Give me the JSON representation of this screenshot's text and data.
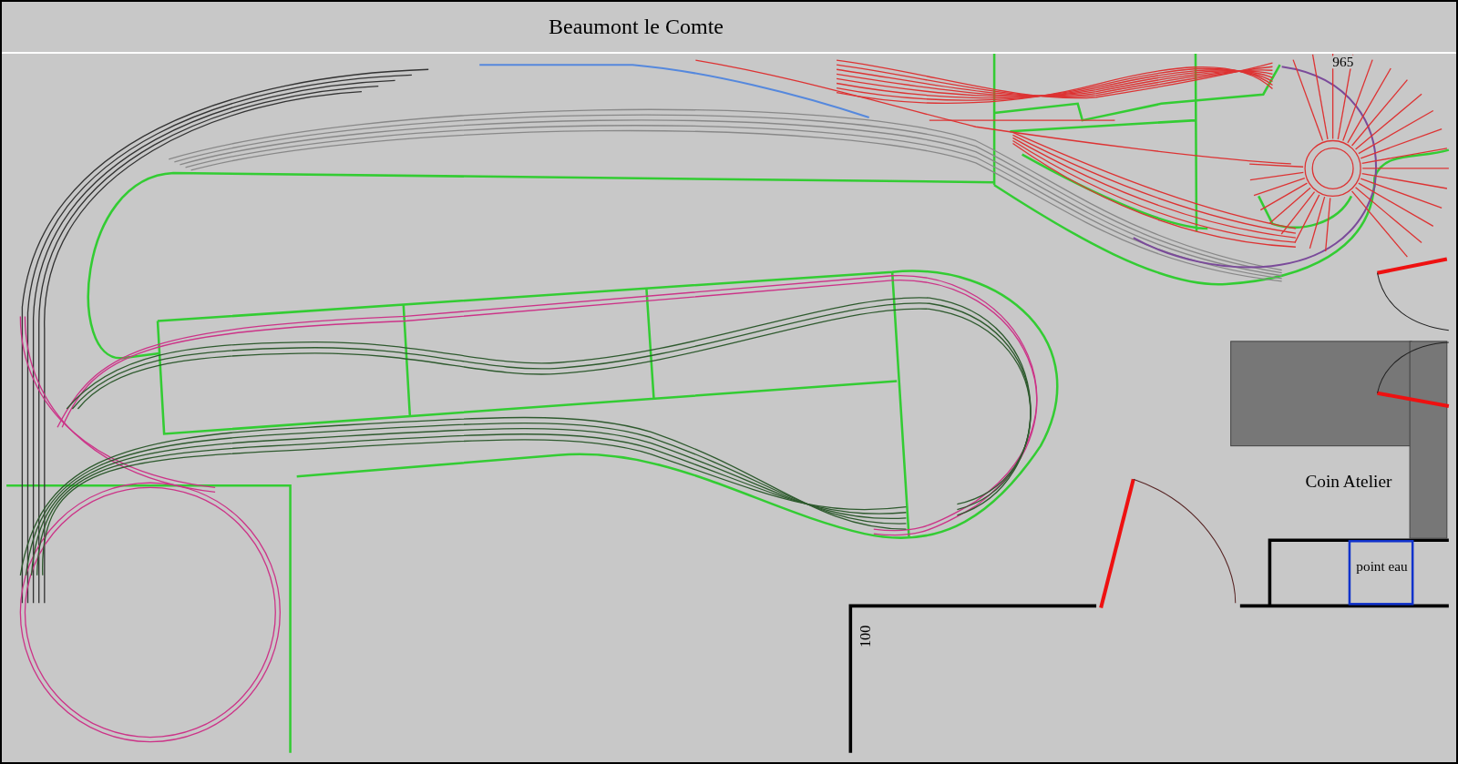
{
  "title": "Beaumont le Comte",
  "labels": [
    {
      "text": "965",
      "kind": "radius"
    },
    {
      "text": "Coin Atelier",
      "kind": "room"
    },
    {
      "text": "point eau",
      "kind": "sink"
    },
    {
      "text": "100",
      "kind": "dimension"
    }
  ]
}
